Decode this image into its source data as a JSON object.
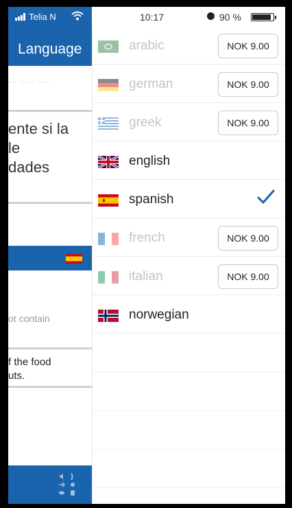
{
  "status_bar": {
    "carrier": "Telia N",
    "time": "10:17",
    "battery": "90 %",
    "battery_level": 0.9
  },
  "background_screen": {
    "header_title": "Language",
    "faded_line": "··· ····· ·····",
    "big_text": [
      "ente si la",
      "le",
      "dades"
    ],
    "gray_text": "ot contain",
    "small_text": [
      "f the food",
      "uts."
    ]
  },
  "languages": [
    {
      "name": "arabic",
      "locked": true,
      "price": "NOK 9.00",
      "icon": "arabic-flag-icon"
    },
    {
      "name": "german",
      "locked": true,
      "price": "NOK 9.00",
      "icon": "german-flag-icon"
    },
    {
      "name": "greek",
      "locked": true,
      "price": "NOK 9.00",
      "icon": "greek-flag-icon"
    },
    {
      "name": "english",
      "locked": false,
      "price": null,
      "icon": "uk-flag-icon"
    },
    {
      "name": "spanish",
      "locked": false,
      "price": null,
      "selected": true,
      "icon": "spanish-flag-icon"
    },
    {
      "name": "french",
      "locked": true,
      "price": "NOK 9.00",
      "icon": "french-flag-icon"
    },
    {
      "name": "italian",
      "locked": true,
      "price": "NOK 9.00",
      "icon": "italian-flag-icon"
    },
    {
      "name": "norwegian",
      "locked": false,
      "price": null,
      "icon": "norwegian-flag-icon"
    }
  ],
  "colors": {
    "brand_blue": "#1a63ad",
    "check_blue": "#1a63ad",
    "locked_text": "#c4c4c4"
  }
}
